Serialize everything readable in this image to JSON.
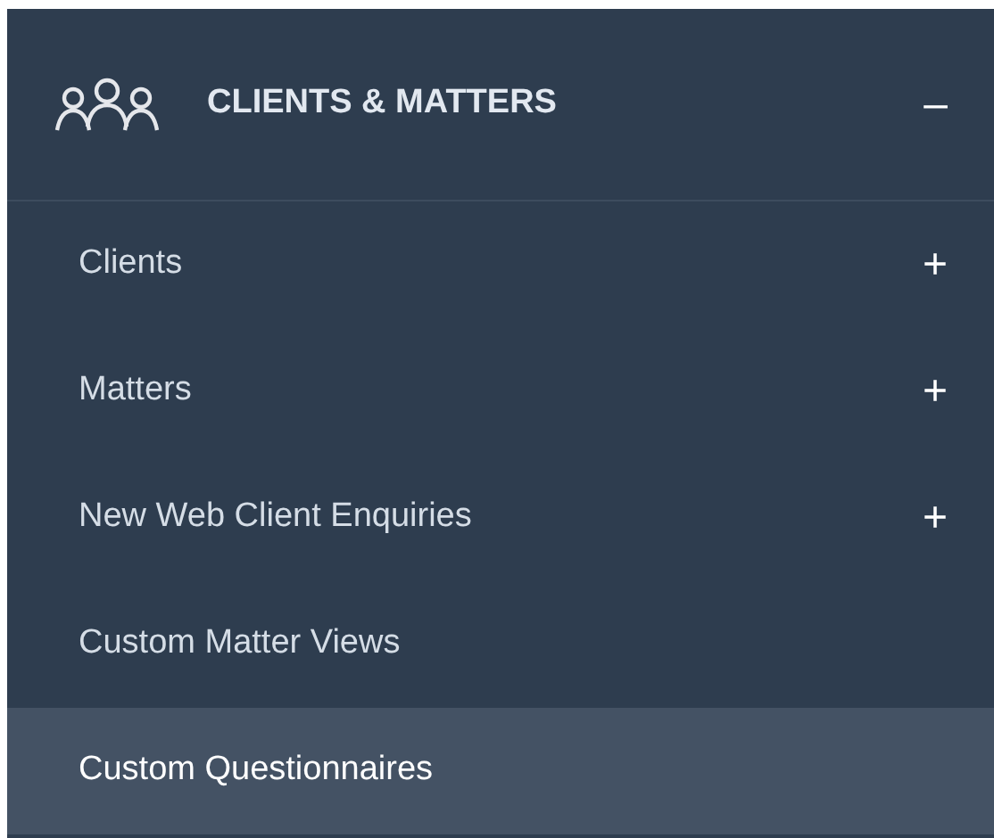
{
  "section": {
    "title": "CLIENTS & MATTERS",
    "expanded": true,
    "toggle": "–"
  },
  "items": [
    {
      "label": "Clients",
      "kind": "group",
      "toggle": "+",
      "selected": false
    },
    {
      "label": "Matters",
      "kind": "group",
      "toggle": "+",
      "selected": false
    },
    {
      "label": "New Web Client Enquiries",
      "kind": "group",
      "toggle": "+",
      "selected": false
    },
    {
      "label": "Custom Matter Views",
      "kind": "link",
      "selected": false
    },
    {
      "label": "Custom Questionnaires",
      "kind": "link",
      "selected": true
    }
  ]
}
